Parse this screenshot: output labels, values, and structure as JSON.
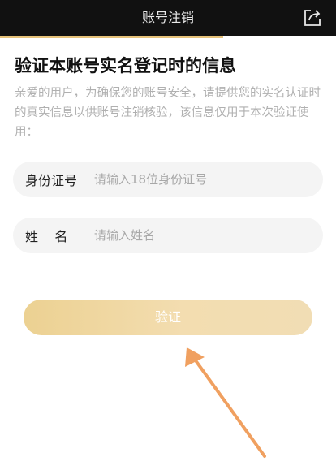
{
  "header": {
    "title": "账号注销",
    "share_icon": "share-icon"
  },
  "main": {
    "heading": "验证本账号实名登记时的信息",
    "description": "亲爱的用户，为确保您的账号安全，请提供您的实名认证时的真实信息以供账号注销核验，该信息仅用于本次验证使用：",
    "fields": [
      {
        "label": "身份证号",
        "placeholder": "请输入18位身份证号"
      },
      {
        "label": "姓    名",
        "placeholder": "请输入姓名"
      }
    ],
    "verify_button": "验证"
  },
  "colors": {
    "topbar": "#111111",
    "accent": "#e6c27a",
    "button_start": "#ecd192",
    "button_end": "#f1ddb4",
    "annotation_arrow": "#f0a060"
  }
}
